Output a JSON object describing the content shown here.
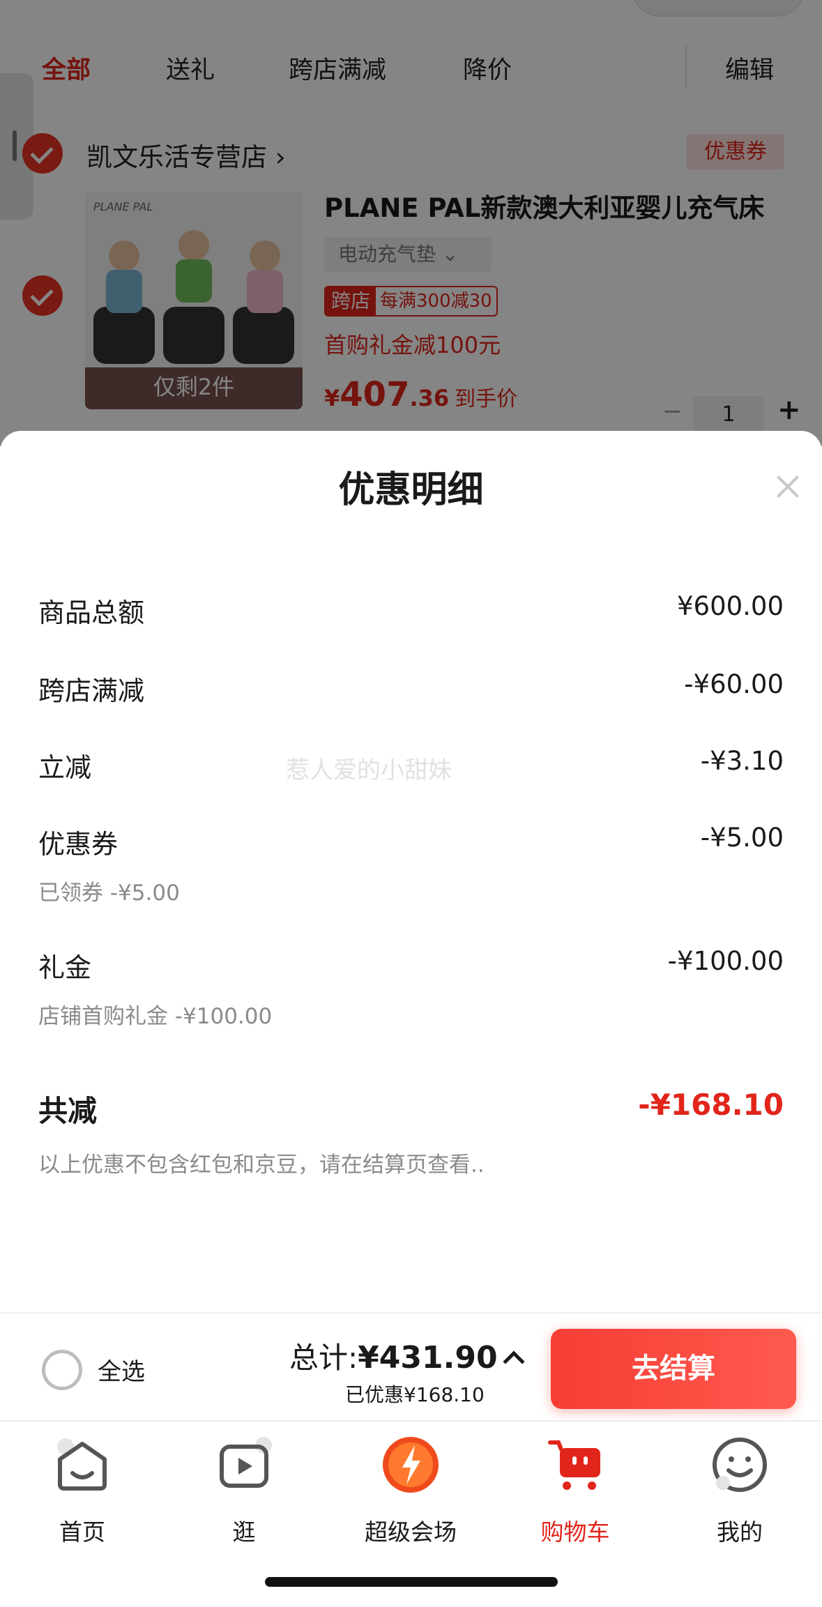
{
  "tabs": [
    {
      "label": "全部",
      "active": true
    },
    {
      "label": "送礼",
      "active": false
    },
    {
      "label": "跨店满减",
      "active": false
    },
    {
      "label": "降价",
      "active": false
    }
  ],
  "edit_label": "编辑",
  "store": {
    "name": "凯文乐活专营店",
    "chevron": "›",
    "coupon_tag": "优惠券"
  },
  "product": {
    "title": "PLANE PAL新款澳大利亚婴儿充气床",
    "brand_text": "PLANE PAL",
    "spec": "电动充气垫",
    "spec_chevron": "⌄",
    "image_overlay": "仅剩2件",
    "promo_tag": "跨店",
    "promo_text": "每满300减30",
    "gift": "首购礼金减100元",
    "price_symbol": "¥",
    "price_int": "407",
    "price_dec": ".36",
    "price_suffix": "到手价",
    "quantity": "1",
    "qty_minus": "−",
    "qty_plus": "+"
  },
  "sheet": {
    "title": "优惠明细",
    "rows": [
      {
        "label": "商品总额",
        "value": "¥600.00"
      },
      {
        "label": "跨店满减",
        "value": "-¥60.00"
      },
      {
        "label": "立减",
        "value": "-¥3.10"
      },
      {
        "label": "优惠券",
        "value": "-¥5.00",
        "sub": "已领券 -¥5.00"
      },
      {
        "label": "礼金",
        "value": "-¥100.00",
        "sub": "店铺首购礼金 -¥100.00"
      }
    ],
    "total_label": "共减",
    "total_value": "-¥168.10",
    "note": "以上优惠不包含红包和京豆，请在结算页查看..",
    "watermark": "惹人爱的小甜妹"
  },
  "checkout": {
    "select_all": "全选",
    "total_prefix": "总计:",
    "total_value": "¥431.90",
    "saved": "已优惠¥168.10",
    "button": "去结算"
  },
  "nav": [
    {
      "label": "首页",
      "icon": "home-icon"
    },
    {
      "label": "逛",
      "icon": "video-play-icon"
    },
    {
      "label": "超级会场",
      "icon": "super-venue-icon"
    },
    {
      "label": "购物车",
      "icon": "cart-icon",
      "active": true
    },
    {
      "label": "我的",
      "icon": "smiley-profile-icon"
    }
  ],
  "colors": {
    "accent": "#e1251b",
    "checkout_button": "#f63d35"
  }
}
